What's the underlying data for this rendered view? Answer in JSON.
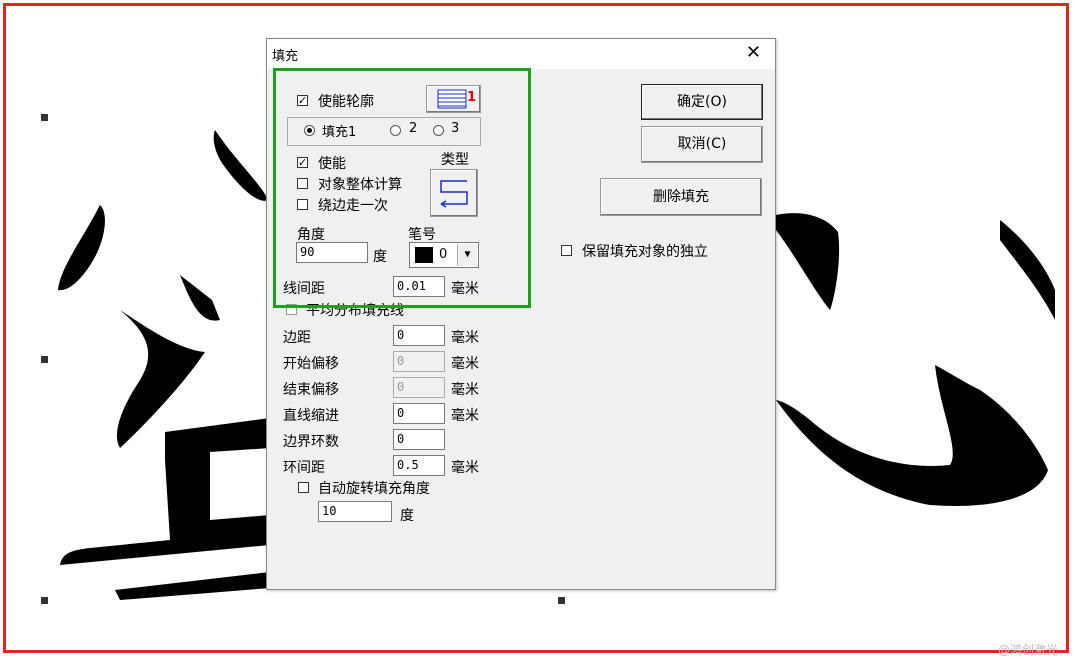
{
  "dialog": {
    "title": "填充",
    "enable_outline_label": "使能轮廓",
    "outline_style_badge": "1",
    "fill_tabs": {
      "fill1": "填充1",
      "fill2": "2",
      "fill3": "3"
    },
    "enable_label": "使能",
    "whole_object_calc_label": "对象整体计算",
    "around_edge_once_label": "绕边走一次",
    "type_label": "类型",
    "angle_label": "角度",
    "angle_value": "90",
    "angle_unit": "度",
    "pen_label": "笔号",
    "pen_value": "0",
    "line_spacing_label": "线间距",
    "line_spacing_value": "0.01",
    "mm": "毫米",
    "even_distribute_label": "平均分布填充线",
    "margin_label": "边距",
    "margin_value": "0",
    "start_offset_label": "开始偏移",
    "start_offset_value": "0",
    "end_offset_label": "结束偏移",
    "end_offset_value": "0",
    "line_indent_label": "直线缩进",
    "line_indent_value": "0",
    "border_loops_label": "边界环数",
    "border_loops_value": "0",
    "loop_spacing_label": "环间距",
    "loop_spacing_value": "0.5",
    "auto_rotate_label": "自动旋转填充角度",
    "auto_rotate_value": "10",
    "auto_rotate_unit": "度",
    "ok_label": "确定(O)",
    "cancel_label": "取消(C)",
    "delete_fill_label": "删除填充",
    "keep_independent_label": "保留填充对象的独立"
  },
  "watermark": "@鸿创激光",
  "colors": {
    "highlight_red": "#e0261b",
    "highlight_green": "#1ea21e"
  }
}
